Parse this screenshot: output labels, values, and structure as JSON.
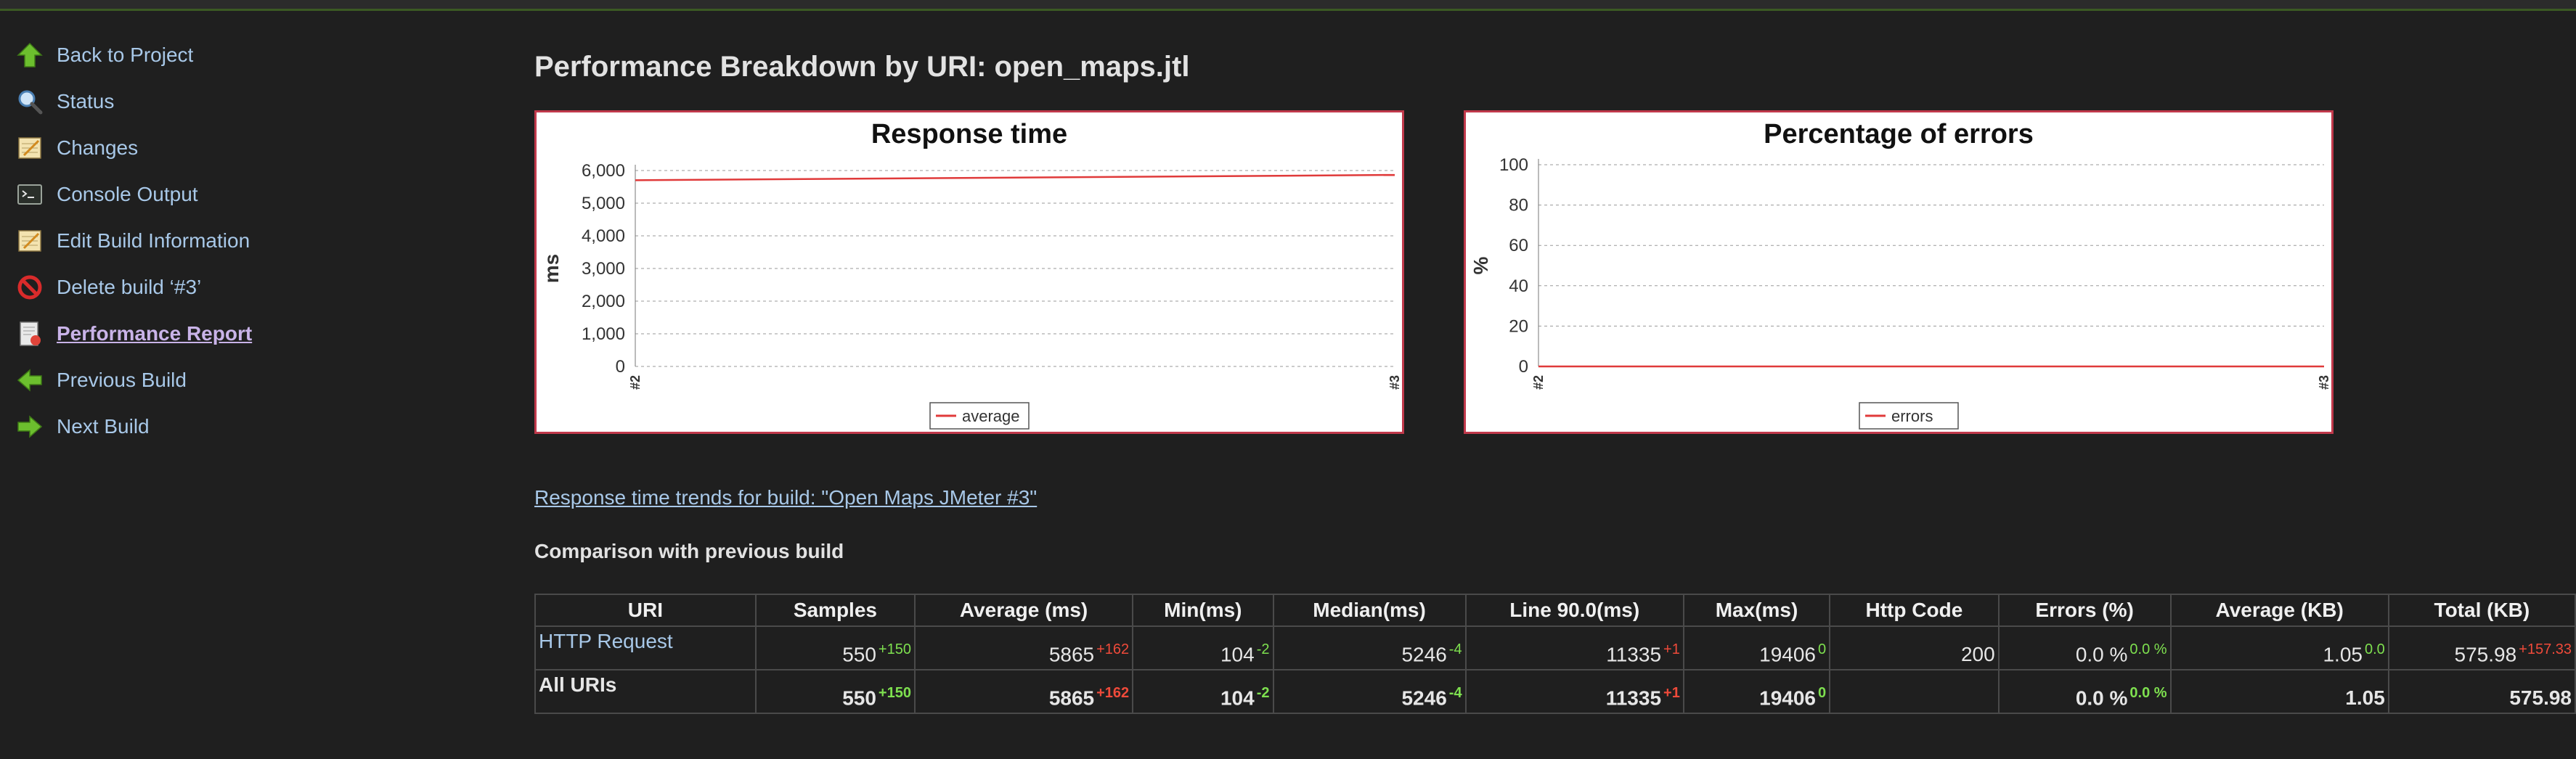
{
  "sidebar": {
    "items": [
      {
        "label": "Back to Project",
        "icon": "up-arrow-icon"
      },
      {
        "label": "Status",
        "icon": "magnifier-icon"
      },
      {
        "label": "Changes",
        "icon": "notepad-icon"
      },
      {
        "label": "Console Output",
        "icon": "terminal-icon"
      },
      {
        "label": "Edit Build Information",
        "icon": "notepad-icon"
      },
      {
        "label": "Delete build ‘#3’",
        "icon": "no-entry-icon"
      },
      {
        "label": "Performance Report",
        "icon": "report-icon",
        "active": true
      },
      {
        "label": "Previous Build",
        "icon": "left-arrow-icon"
      },
      {
        "label": "Next Build",
        "icon": "right-arrow-icon"
      }
    ]
  },
  "page": {
    "title": "Performance Breakdown by URI: open_maps.jtl",
    "trend_link": "Response time trends for build: \"Open Maps JMeter #3\"",
    "comparison_title": "Comparison with previous build"
  },
  "chart_data": [
    {
      "type": "line",
      "title": "Response time",
      "ylabel": "ms",
      "xlabel": "",
      "x": [
        "#2",
        "#3"
      ],
      "yticks": [
        "0",
        "1,000",
        "2,000",
        "3,000",
        "4,000",
        "5,000",
        "6,000"
      ],
      "ylim": [
        0,
        6000
      ],
      "grid": true,
      "legend": "bottom-center",
      "series": [
        {
          "name": "average",
          "values": [
            5703,
            5865
          ],
          "color": "#e03a3a"
        }
      ]
    },
    {
      "type": "line",
      "title": "Percentage of errors",
      "ylabel": "%",
      "xlabel": "",
      "x": [
        "#2",
        "#3"
      ],
      "yticks": [
        "0",
        "20",
        "40",
        "60",
        "80",
        "100"
      ],
      "ylim": [
        0,
        100
      ],
      "grid": true,
      "legend": "bottom-center",
      "series": [
        {
          "name": "errors",
          "values": [
            0,
            0
          ],
          "color": "#e03a3a"
        }
      ]
    }
  ],
  "table": {
    "headers": [
      "URI",
      "Samples",
      "Average (ms)",
      "Min(ms)",
      "Median(ms)",
      "Line 90.0(ms)",
      "Max(ms)",
      "Http Code",
      "Errors (%)",
      "Average (KB)",
      "Total (KB)"
    ],
    "rows": [
      {
        "uri": "HTTP Request",
        "cells": [
          {
            "value": "550",
            "delta": "+150",
            "tone": "pos"
          },
          {
            "value": "5865",
            "delta": "+162",
            "tone": "neg"
          },
          {
            "value": "104",
            "delta": "-2",
            "tone": "pos"
          },
          {
            "value": "5246",
            "delta": "-4",
            "tone": "pos"
          },
          {
            "value": "11335",
            "delta": "+1",
            "tone": "neg"
          },
          {
            "value": "19406",
            "delta": "0",
            "tone": "pos"
          },
          {
            "value": "200",
            "delta": "",
            "tone": ""
          },
          {
            "value": "0.0 %",
            "delta": "0.0 %",
            "tone": "pos"
          },
          {
            "value": "1.05",
            "delta": "0.0",
            "tone": "pos"
          },
          {
            "value": "575.98",
            "delta": "+157.33",
            "tone": "neg"
          }
        ]
      },
      {
        "uri": "All URIs",
        "cells": [
          {
            "value": "550",
            "delta": "+150",
            "tone": "pos"
          },
          {
            "value": "5865",
            "delta": "+162",
            "tone": "neg"
          },
          {
            "value": "104",
            "delta": "-2",
            "tone": "pos"
          },
          {
            "value": "5246",
            "delta": "-4",
            "tone": "pos"
          },
          {
            "value": "11335",
            "delta": "+1",
            "tone": "neg"
          },
          {
            "value": "19406",
            "delta": "0",
            "tone": "pos"
          },
          {
            "value": "",
            "delta": "",
            "tone": ""
          },
          {
            "value": "0.0 %",
            "delta": "0.0 %",
            "tone": "pos"
          },
          {
            "value": "1.05",
            "delta": "",
            "tone": ""
          },
          {
            "value": "575.98",
            "delta": "",
            "tone": ""
          }
        ]
      }
    ]
  }
}
